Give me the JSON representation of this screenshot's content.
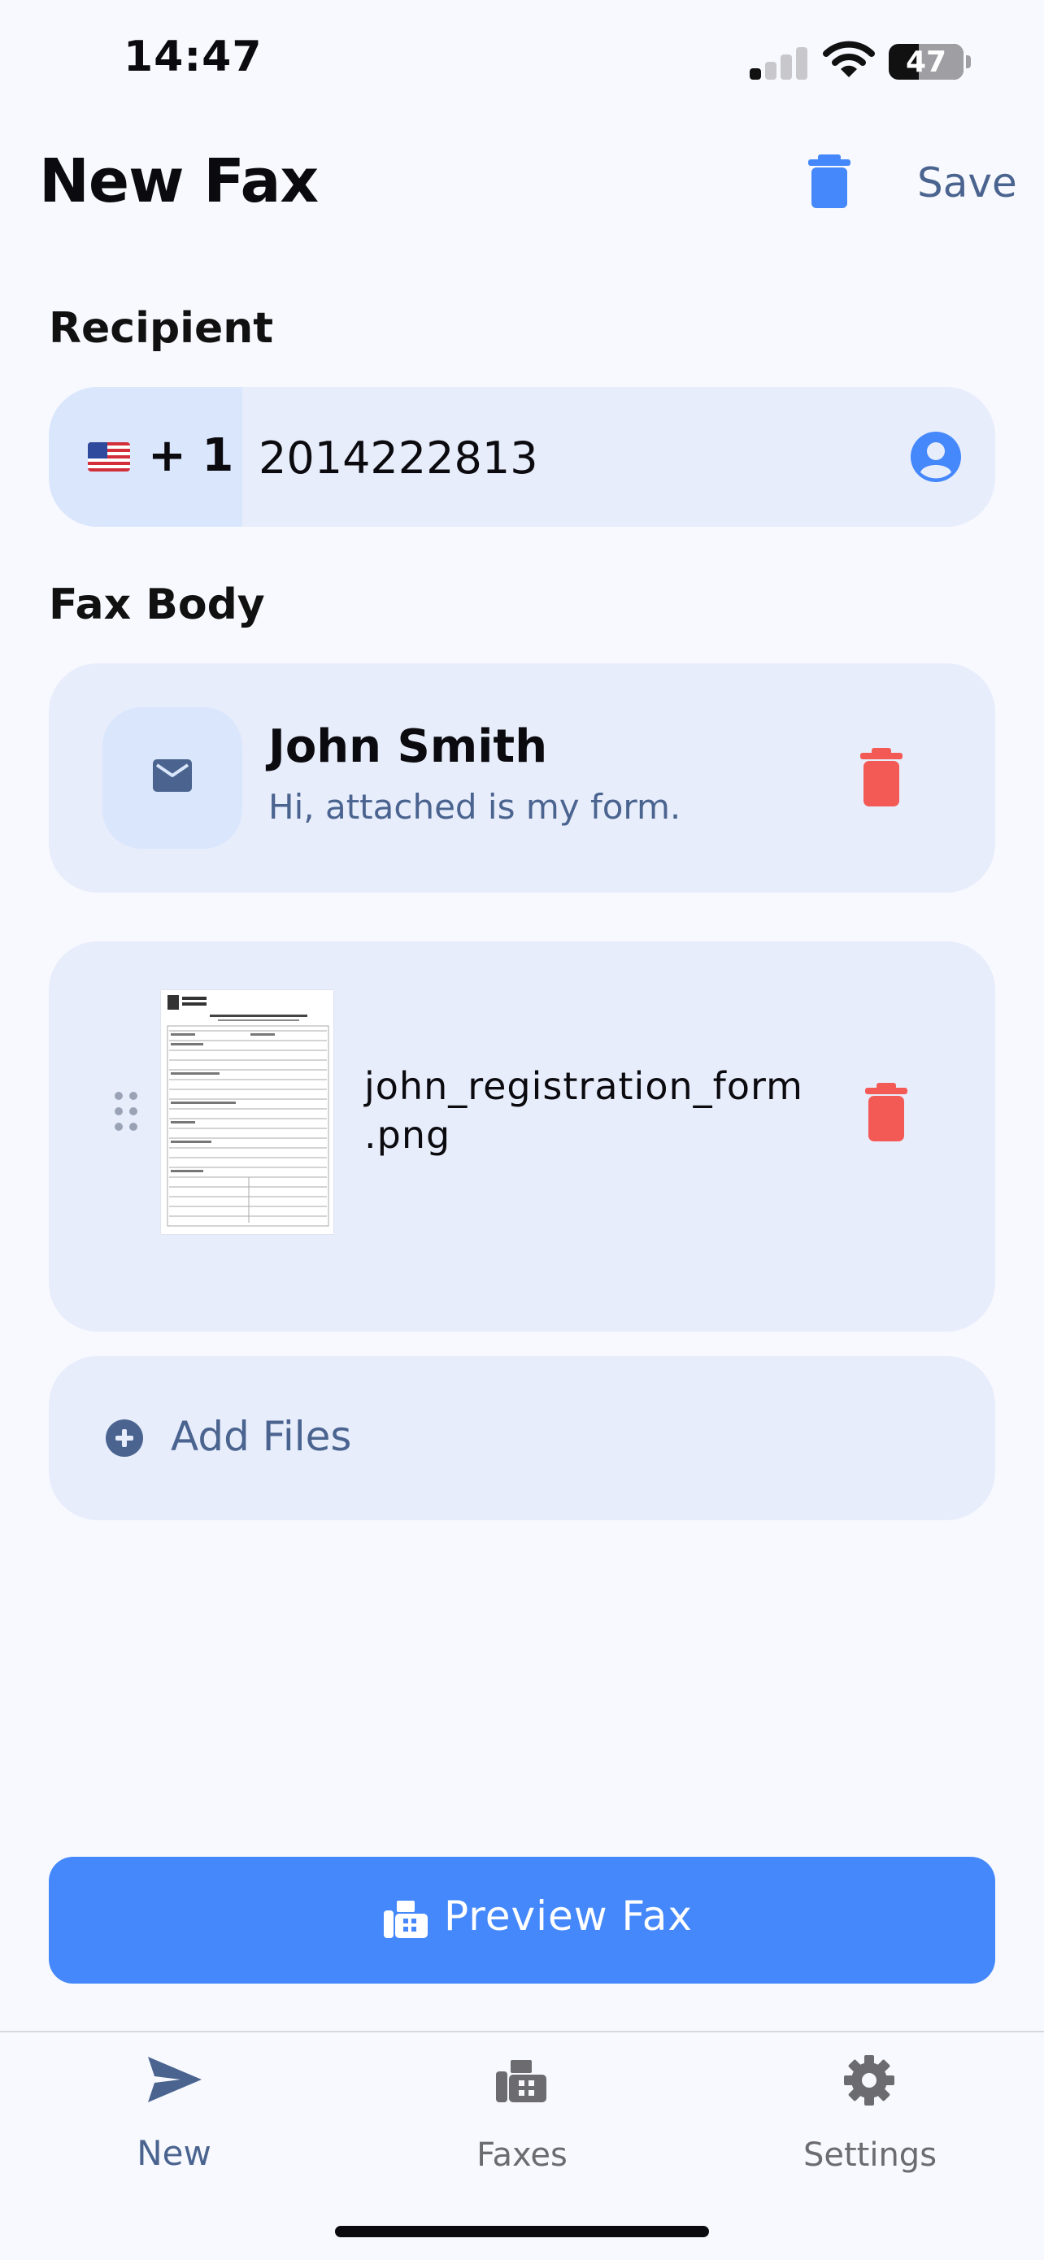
{
  "status_bar": {
    "time": "14:47",
    "battery": "47",
    "battery_level": 0.47
  },
  "header": {
    "title": "New Fax",
    "save_label": "Save"
  },
  "recipient": {
    "section_label": "Recipient",
    "country_code": "+ 1",
    "country_flag_icon": "us-flag-icon",
    "phone_number": "2014222813",
    "contact_icon": "person-circle-icon"
  },
  "fax_body": {
    "section_label": "Fax Body",
    "message": {
      "icon": "envelope-icon",
      "name": "John Smith",
      "text": "Hi, attached is my form."
    },
    "attachment": {
      "icon": "drag-handle-icon",
      "file_name": "john_registration_form\n.png"
    },
    "add_files_label": "Add Files"
  },
  "preview_button": {
    "label": "Preview Fax",
    "icon": "fax-icon"
  },
  "tabs": [
    {
      "label": "New",
      "icon": "paper-plane-icon",
      "active": true
    },
    {
      "label": "Faxes",
      "icon": "fax-icon",
      "active": false
    },
    {
      "label": "Settings",
      "icon": "gear-icon",
      "active": false
    }
  ],
  "colors": {
    "accent": "#4488fb",
    "muted_accent": "#4a648f",
    "delete": "#f45a55",
    "card_background": "#e8edfc",
    "page_background": "#f8f9fe"
  }
}
